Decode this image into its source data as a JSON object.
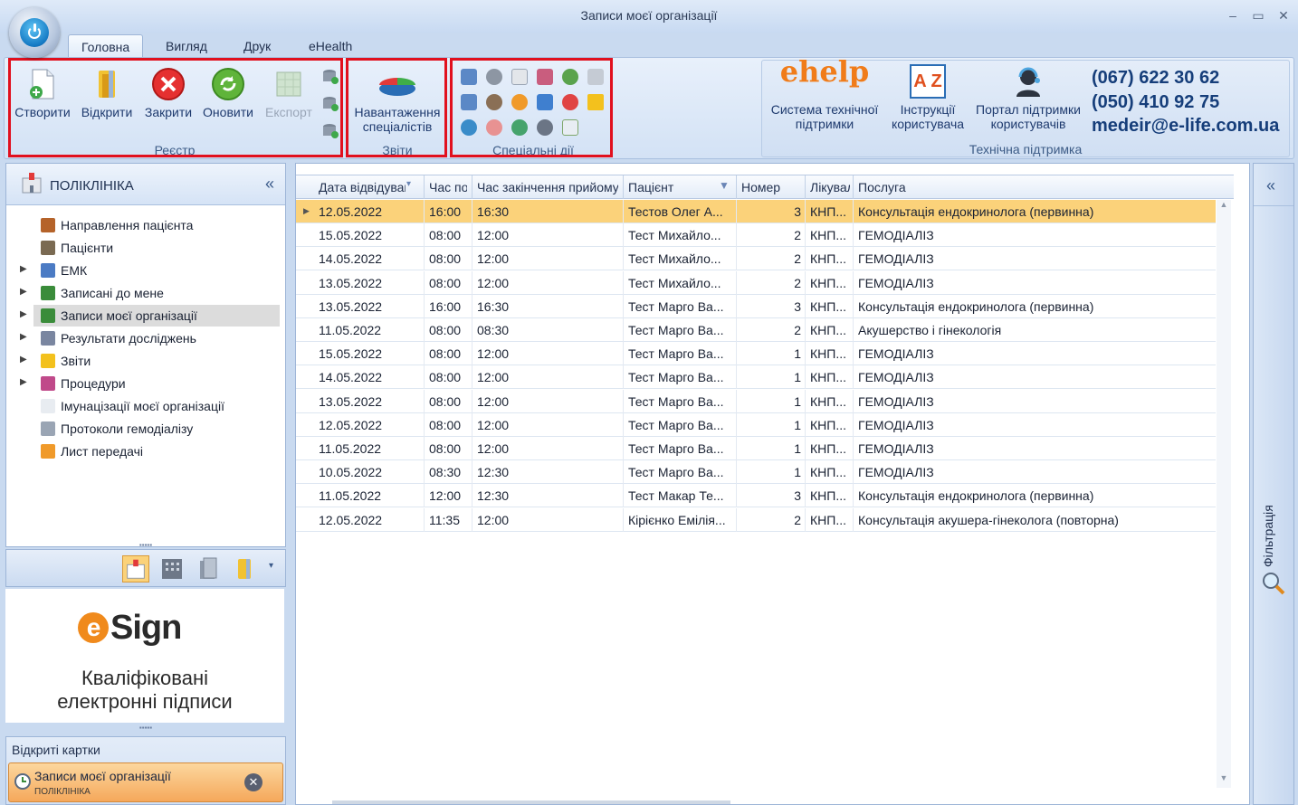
{
  "window": {
    "title": "Записи моєї організації",
    "minimize": "‒",
    "maximize": "▭",
    "close": "✕"
  },
  "tabs": [
    "Головна",
    "Вигляд",
    "Друк",
    "eHealth"
  ],
  "ribbon": {
    "registry": {
      "label": "Реєстр",
      "buttons": {
        "create": "Створити",
        "open": "Відкрити",
        "close": "Закрити",
        "refresh": "Оновити",
        "export": "Експорт"
      }
    },
    "reports": {
      "label": "Звіти",
      "button_line1": "Навантаження",
      "button_line2": "спеціалістів"
    },
    "special": {
      "label": "Спеціальні дії"
    },
    "support": {
      "label": "Технічна підтримка",
      "system_line1": "Система технічної",
      "system_line2": "підтримки",
      "instructions_line1": "Інструкції",
      "instructions_line2": "користувача",
      "portal_line1": "Портал підтримки",
      "portal_line2": "користувачів",
      "ehelp_logo": "ehelp",
      "az_logo": "A Z"
    },
    "contacts": {
      "phone1": "(067) 622 30 62",
      "phone2": "(050) 410 92 75",
      "email": "medeir@e-life.com.ua"
    }
  },
  "left_panel": {
    "title": "ПОЛІКЛІНІКА",
    "collapse": "«",
    "items": [
      {
        "label": "Направлення пацієнта",
        "icon": "referral-icon",
        "expandable": false
      },
      {
        "label": "Пацієнти",
        "icon": "patients-icon",
        "expandable": false
      },
      {
        "label": "ЕМК",
        "icon": "emk-icon",
        "expandable": true
      },
      {
        "label": "Записані до мене",
        "icon": "appointments-to-me-icon",
        "expandable": true
      },
      {
        "label": "Записи моєї організації",
        "icon": "org-appointments-icon",
        "expandable": true,
        "selected": true
      },
      {
        "label": "Результати досліджень",
        "icon": "hourglass-icon",
        "expandable": true
      },
      {
        "label": "Звіти",
        "icon": "folder-icon",
        "expandable": true
      },
      {
        "label": "Процедури",
        "icon": "procedures-icon",
        "expandable": true
      },
      {
        "label": "Імунацізації моєї організації",
        "icon": "document-icon",
        "expandable": false
      },
      {
        "label": "Протоколи гемодіалізу",
        "icon": "protocol-icon",
        "expandable": false
      },
      {
        "label": "Лист передачі",
        "icon": "folder-orange-icon",
        "expandable": false
      }
    ]
  },
  "esign": {
    "logo": "Sign",
    "logo_e": "e",
    "line1": "Кваліфіковані",
    "line2": "електронні підписи"
  },
  "open_cards": {
    "header": "Відкриті картки",
    "card_title": "Записи моєї організації",
    "card_subtitle": "ПОЛІКЛІНІКА",
    "close": "✕"
  },
  "grid": {
    "columns": [
      "Дата відвідування",
      "Час початку",
      "Час закінчення прийому",
      "Пацієнт",
      "Номер",
      "Лікувальний заклад",
      "Послуга"
    ],
    "rows": [
      [
        "12.05.2022",
        "16:00",
        "16:30",
        "Тестов Олег А...",
        "3",
        "КНП...",
        "Консультація ендокринолога (первинна)"
      ],
      [
        "15.05.2022",
        "08:00",
        "12:00",
        "Тест Михайло...",
        "2",
        "КНП...",
        "ГЕМОДІАЛІЗ"
      ],
      [
        "14.05.2022",
        "08:00",
        "12:00",
        "Тест Михайло...",
        "2",
        "КНП...",
        "ГЕМОДІАЛІЗ"
      ],
      [
        "13.05.2022",
        "08:00",
        "12:00",
        "Тест Михайло...",
        "2",
        "КНП...",
        "ГЕМОДІАЛІЗ"
      ],
      [
        "13.05.2022",
        "16:00",
        "16:30",
        "Тест Марго Ва...",
        "3",
        "КНП...",
        "Консультація ендокринолога (первинна)"
      ],
      [
        "11.05.2022",
        "08:00",
        "08:30",
        "Тест Марго Ва...",
        "2",
        "КНП...",
        "Акушерство і гінекологія"
      ],
      [
        "15.05.2022",
        "08:00",
        "12:00",
        "Тест Марго Ва...",
        "1",
        "КНП...",
        "ГЕМОДІАЛІЗ"
      ],
      [
        "14.05.2022",
        "08:00",
        "12:00",
        "Тест Марго Ва...",
        "1",
        "КНП...",
        "ГЕМОДІАЛІЗ"
      ],
      [
        "13.05.2022",
        "08:00",
        "12:00",
        "Тест Марго Ва...",
        "1",
        "КНП...",
        "ГЕМОДІАЛІЗ"
      ],
      [
        "12.05.2022",
        "08:00",
        "12:00",
        "Тест Марго Ва...",
        "1",
        "КНП...",
        "ГЕМОДІАЛІЗ"
      ],
      [
        "11.05.2022",
        "08:00",
        "12:00",
        "Тест Марго Ва...",
        "1",
        "КНП...",
        "ГЕМОДІАЛІЗ"
      ],
      [
        "10.05.2022",
        "08:30",
        "12:30",
        "Тест Марго Ва...",
        "1",
        "КНП...",
        "ГЕМОДІАЛІЗ"
      ],
      [
        "11.05.2022",
        "12:00",
        "12:30",
        "Тест Макар Те...",
        "3",
        "КНП...",
        "Консультація ендокринолога (первинна)"
      ],
      [
        "12.05.2022",
        "11:35",
        "12:00",
        "Кірієнко Емілія...",
        "2",
        "КНП...",
        "Консультація акушера-гінеколога (повторна)"
      ]
    ],
    "selected_row": 0
  },
  "filter_panel": {
    "collapse": "«",
    "label": "Фільтрація"
  },
  "colors": {
    "selection": "#fbd27a",
    "highlight_box": "#e1101e",
    "brand_blue": "#163e7a"
  }
}
